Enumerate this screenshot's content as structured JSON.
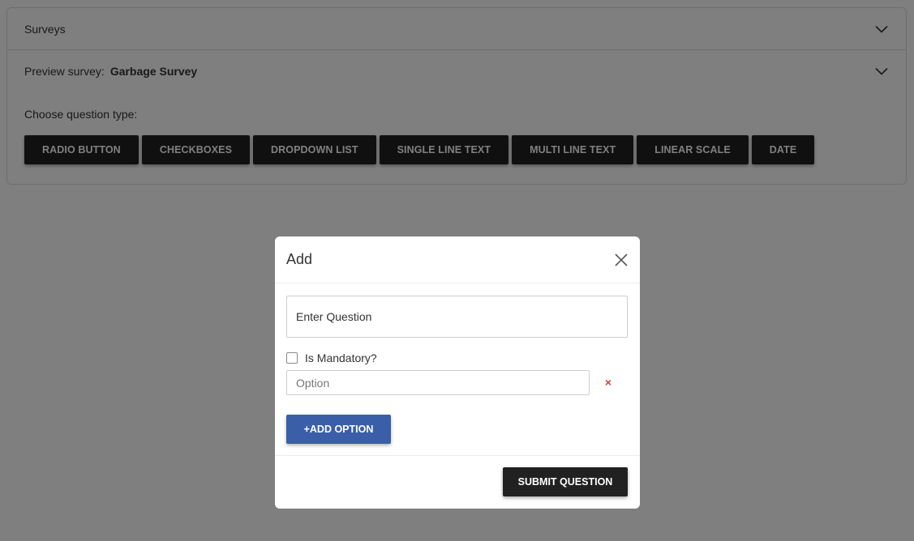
{
  "accordion": {
    "surveys_label": "Surveys",
    "preview_label": "Preview survey:",
    "preview_survey_name": "Garbage Survey"
  },
  "question_types": {
    "label": "Choose question type:",
    "buttons": [
      "RADIO BUTTON",
      "CHECKBOXES",
      "DROPDOWN LIST",
      "SINGLE LINE TEXT",
      "MULTI LINE TEXT",
      "LINEAR SCALE",
      "DATE"
    ]
  },
  "modal": {
    "title": "Add",
    "question_placeholder": "Enter Question",
    "question_value": "",
    "mandatory_label": "Is Mandatory?",
    "mandatory_checked": false,
    "option_placeholder": "Option",
    "option_value": "",
    "remove_option_glyph": "×",
    "add_option_label": "+ADD OPTION",
    "submit_label": "SUBMIT QUESTION"
  },
  "icons": {
    "chevron": "chevron-down-icon",
    "close": "close-icon"
  },
  "colors": {
    "dark_button": "#212121",
    "primary_button": "#3a5ea8",
    "remove_icon": "#e53935",
    "overlay": "rgba(0,0,0,0.5)"
  }
}
